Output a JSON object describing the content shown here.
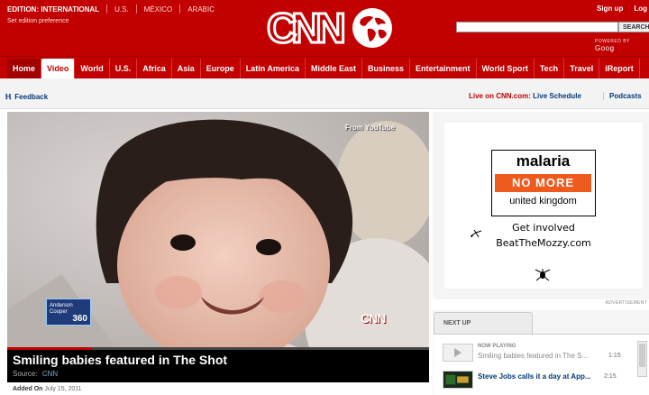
{
  "header": {
    "edition_label": "EDITION:",
    "edition_value": "INTERNATIONAL",
    "edition_links": [
      "U.S.",
      "MÉXICO",
      "ARABIC"
    ],
    "set_edition": "Set edition preference",
    "logo_text": "CNN",
    "signup": "Sign up",
    "login": "Log",
    "search_button": "SEARCH",
    "search_placeholder": "",
    "powered_by": "POWERED BY",
    "powered_brand": "Goog"
  },
  "nav": {
    "items": [
      "Home",
      "Video",
      "World",
      "U.S.",
      "Africa",
      "Asia",
      "Europe",
      "Latin America",
      "Middle East",
      "Business",
      "Entertainment",
      "World Sport",
      "Tech",
      "Travel",
      "iReport"
    ],
    "active": "Video"
  },
  "subbar": {
    "feedback": "Feedback",
    "live_prefix": "Live on CNN.com:",
    "live_schedule": "Live Schedule",
    "podcasts": "Podcasts"
  },
  "video": {
    "overlay_source": "From YouTube",
    "badge_line1": "Anderson",
    "badge_line2": "Cooper",
    "badge_number": "360",
    "bug": "CNN",
    "title": "Smiling babies featured in The Shot",
    "source_label": "Source:",
    "source_value": "CNN",
    "progress_fraction": 0.2,
    "added_label": "Added On",
    "added_date": "July 15, 2011"
  },
  "ad": {
    "line1": "malaria",
    "line2": "NO MORE",
    "line3": "united kingdom",
    "get_involved": "Get involved",
    "site": "BeatTheMozzy.com",
    "advertisement_label": "ADVERTISEMENT"
  },
  "next_up": {
    "tab_label": "NEXT UP",
    "items": [
      {
        "status": "NOW PLAYING",
        "title": "Smiling babies featured in The S...",
        "duration": "1:15"
      },
      {
        "status": "",
        "title": "Steve Jobs calls it a day at App...",
        "duration": "2:15"
      }
    ]
  },
  "colors": {
    "brand_red": "#c20000",
    "link_blue": "#003a78",
    "ad_orange": "#ef5b1e"
  }
}
